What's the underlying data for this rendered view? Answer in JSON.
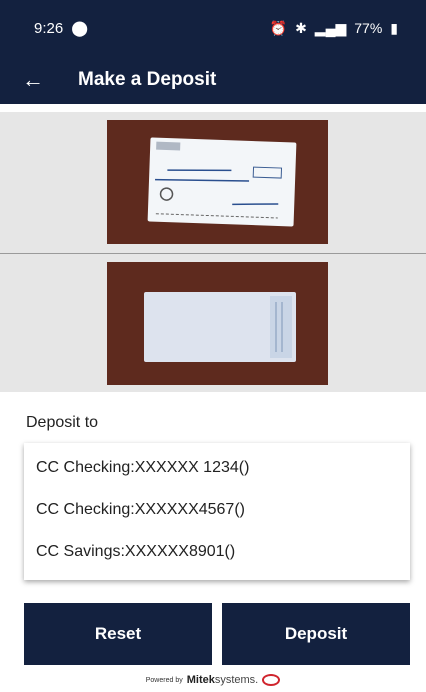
{
  "status_bar": {
    "time": "9:26",
    "battery": "77%"
  },
  "header": {
    "title": "Make a Deposit",
    "back_icon": "arrow-left-icon"
  },
  "deposit": {
    "label": "Deposit to",
    "accounts": [
      {
        "label": "CC Checking:XXXXXX 1234()"
      },
      {
        "label": "CC Checking:XXXXXX4567()"
      },
      {
        "label": "CC Savings:XXXXXX8901()"
      }
    ]
  },
  "buttons": {
    "reset": "Reset",
    "deposit": "Deposit"
  },
  "footer": {
    "powered_by": "Powered by",
    "brand": "Mitek",
    "brand_suffix": "systems."
  },
  "colors": {
    "primary": "#13213f",
    "image_bg": "#e6e6e6",
    "accent": "#d0252e"
  }
}
